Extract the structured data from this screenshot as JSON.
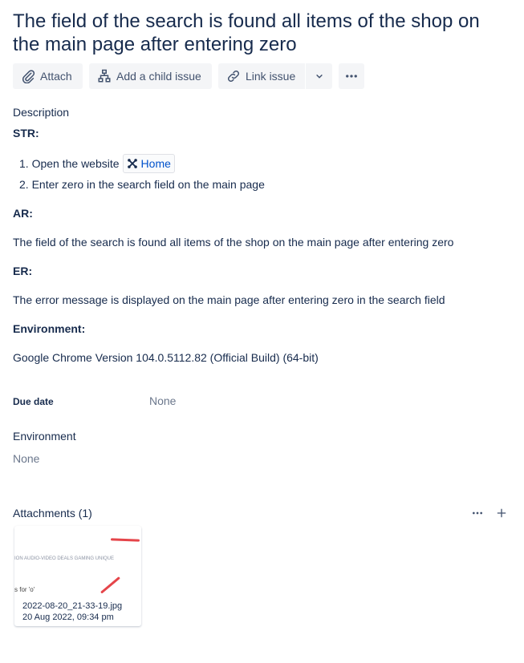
{
  "issue": {
    "title": "The field of the search is found all items of the shop on the main page after entering zero"
  },
  "toolbar": {
    "attach_label": "Attach",
    "child_label": "Add a child issue",
    "link_label": "Link issue"
  },
  "description": {
    "heading": "Description",
    "str_label": "STR:",
    "steps": [
      {
        "number": "1.",
        "text": "Open the website",
        "link_label": "Home"
      },
      {
        "number": "2.",
        "text": "Enter zero in the search field on the main page"
      }
    ],
    "ar_label": "AR:",
    "ar_text": "The field of the search is found all items of the shop on the main page after entering zero",
    "er_label": "ER:",
    "er_text": "The error message is displayed on the main page after entering zero in the search field",
    "env_label": "Environment:",
    "env_text": "Google Chrome Version 104.0.5112.82 (Official Build) (64-bit)"
  },
  "fields": {
    "due_date_label": "Due date",
    "due_date_value": "None",
    "environment_label": "Environment",
    "environment_value": "None"
  },
  "attachments": {
    "heading": "Attachments (1)",
    "items": [
      {
        "filename": "2022-08-20_21-33-19.jpg",
        "date": "20 Aug 2022, 09:34 pm",
        "preview_menu": "ION    AUDIO-VIDEO    DEALS    GAMING    UNIQUE",
        "preview_text": "s for 'o'"
      }
    ]
  },
  "colors": {
    "text": "#172b4d",
    "muted": "#6b778c",
    "button_bg": "#f4f5f7",
    "link": "#0052cc",
    "annotation_red": "#e5454a"
  }
}
